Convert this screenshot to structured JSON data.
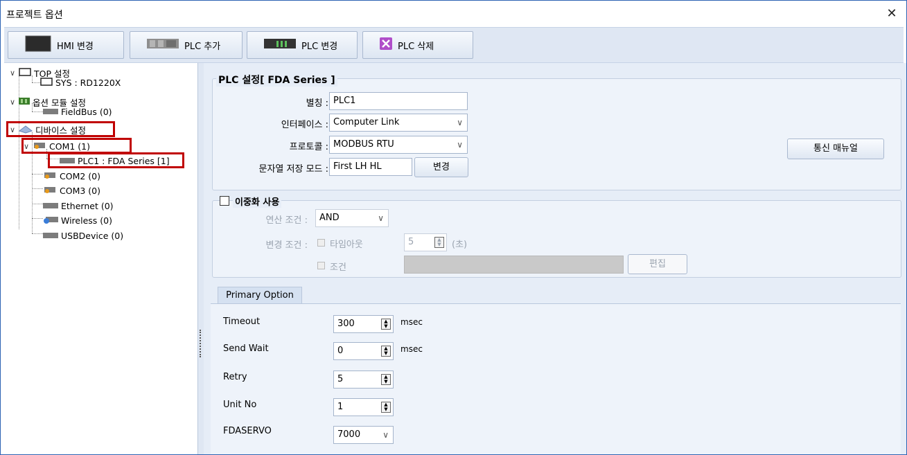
{
  "window": {
    "title": "프로젝트 옵션",
    "close_label": "✕"
  },
  "toolbar": {
    "hmi_change": "HMI 변경",
    "plc_add": "PLC 추가",
    "plc_change": "PLC 변경",
    "plc_delete": "PLC 삭제"
  },
  "tree": {
    "top": "TOP 설정",
    "sys": "SYS : RD1220X",
    "option_module": "옵션 모듈 설정",
    "fieldbus": "FieldBus (0)",
    "device": "디바이스 설정",
    "com1": "COM1 (1)",
    "plc1": "PLC1 : FDA Series [1]",
    "com2": "COM2 (0)",
    "com3": "COM3 (0)",
    "ethernet": "Ethernet (0)",
    "wireless": "Wireless (0)",
    "usbdevice": "USBDevice (0)"
  },
  "plc_settings": {
    "group_title": "PLC 설정[ FDA Series ]",
    "alias_label": "별칭 :",
    "alias_value": "PLC1",
    "interface_label": "인터페이스 :",
    "interface_value": "Computer Link",
    "protocol_label": "프로토콜 :",
    "protocol_value": "MODBUS RTU",
    "string_mode_label": "문자열 저장 모드 :",
    "string_mode_value": "First LH HL",
    "change_button": "변경",
    "manual_button": "통신 매뉴얼"
  },
  "redundancy": {
    "title": "이중화 사용",
    "op_condition_label": "연산 조건 :",
    "op_condition_value": "AND",
    "change_condition_label": "변경 조건 :",
    "timeout_label": "타임아웃",
    "timeout_value": "5",
    "timeout_unit": "(초)",
    "condition_label": "조건",
    "edit_button": "편집"
  },
  "primary": {
    "tab_label": "Primary Option",
    "timeout_label": "Timeout",
    "timeout_value": "300",
    "timeout_unit": "msec",
    "send_wait_label": "Send Wait",
    "send_wait_value": "0",
    "send_wait_unit": "msec",
    "retry_label": "Retry",
    "retry_value": "5",
    "unit_no_label": "Unit No",
    "unit_no_value": "1",
    "fdaservo_label": "FDASERVO",
    "fdaservo_value": "7000"
  },
  "colors": {
    "highlight": "#c00000",
    "toolbar_bg": "#dfe7f3",
    "panel_bg": "#e6edf7"
  }
}
